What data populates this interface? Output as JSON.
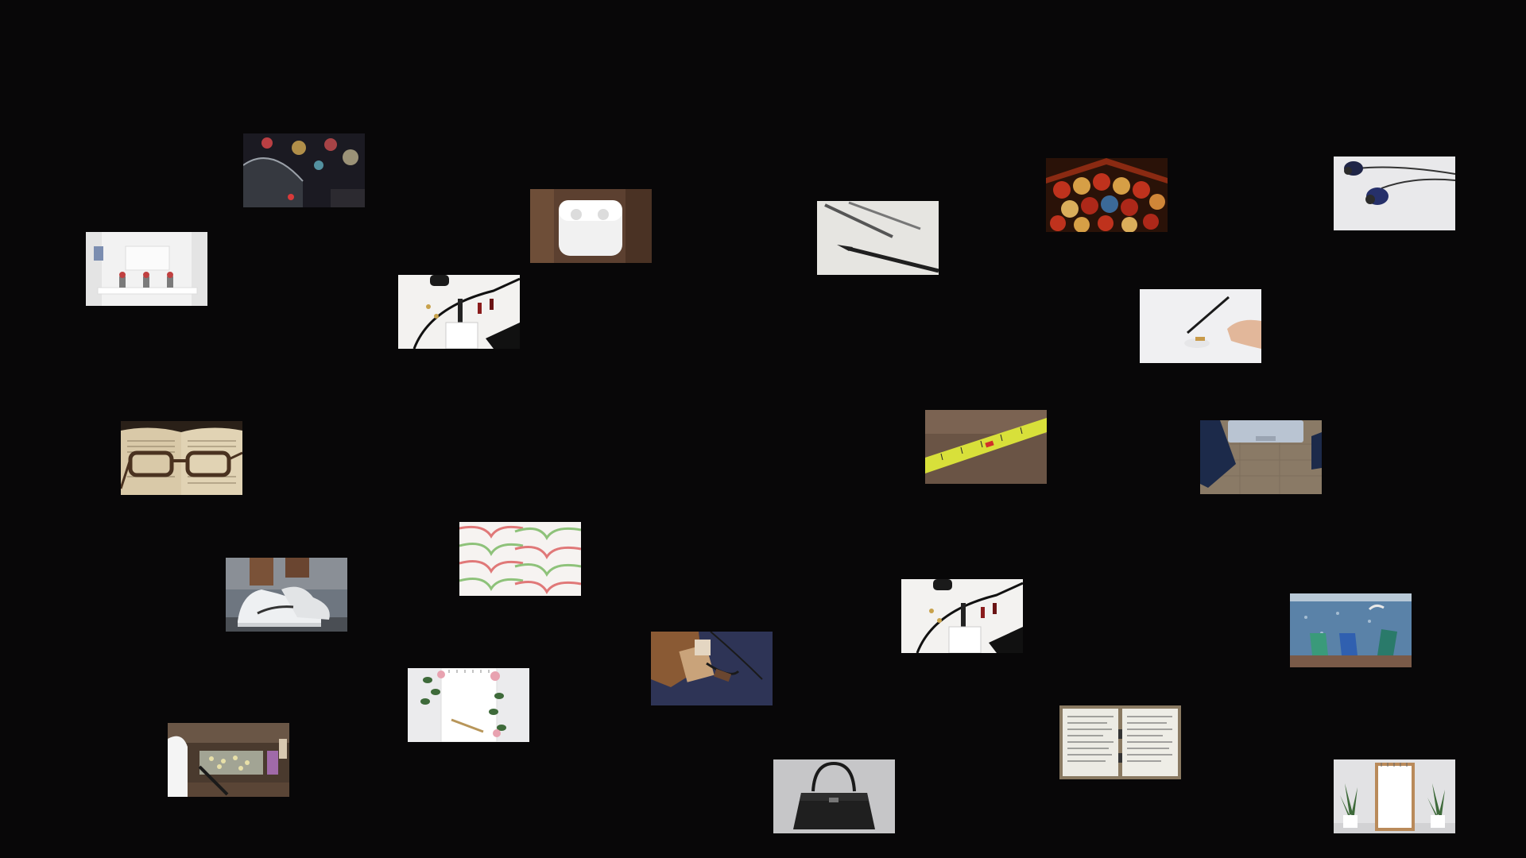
{
  "background": "#080708",
  "thumbnails": [
    {
      "name": "thumb-umbrella-city-night"
    },
    {
      "name": "thumb-airpods-case"
    },
    {
      "name": "thumb-drafting-tools"
    },
    {
      "name": "thumb-paper-lanterns"
    },
    {
      "name": "thumb-earphones"
    },
    {
      "name": "thumb-white-office"
    },
    {
      "name": "thumb-accessories-flatlay"
    },
    {
      "name": "thumb-hand-with-pen"
    },
    {
      "name": "thumb-glasses-on-book"
    },
    {
      "name": "thumb-measuring-tape"
    },
    {
      "name": "thumb-laptop-on-burlap"
    },
    {
      "name": "thumb-paper-clips"
    },
    {
      "name": "thumb-sneakers"
    },
    {
      "name": "thumb-accessories-flatlay-2"
    },
    {
      "name": "thumb-beach-chairs"
    },
    {
      "name": "thumb-leather-bag"
    },
    {
      "name": "thumb-notebook-flowers"
    },
    {
      "name": "thumb-handbag"
    },
    {
      "name": "thumb-open-journal"
    },
    {
      "name": "thumb-lab-glassware"
    },
    {
      "name": "thumb-notepad-plants"
    }
  ]
}
